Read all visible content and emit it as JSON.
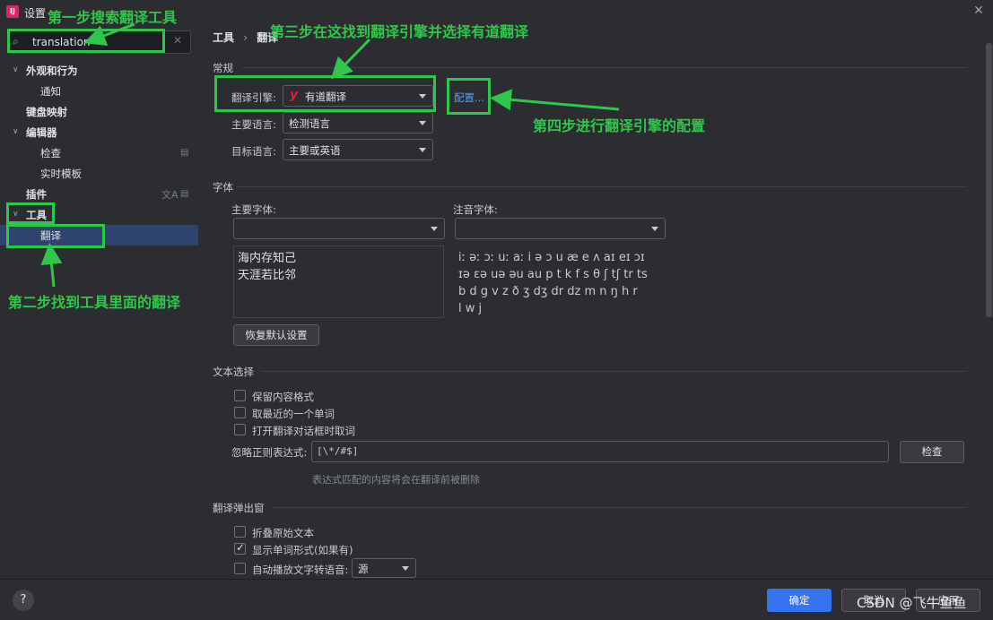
{
  "window": {
    "title": "设置",
    "logo_text": "IJ"
  },
  "search": {
    "value": "translation"
  },
  "sidebar": {
    "items": [
      {
        "label": "外观和行为"
      },
      {
        "label": "通知"
      },
      {
        "label": "键盘映射"
      },
      {
        "label": "编辑器"
      },
      {
        "label": "检查"
      },
      {
        "label": "实时模板"
      },
      {
        "label": "插件"
      },
      {
        "label": "工具"
      },
      {
        "label": "翻译"
      }
    ]
  },
  "breadcrumb": {
    "parent": "工具",
    "sep": "›",
    "current": "翻译"
  },
  "general": {
    "title": "常规",
    "engine_label": "翻译引擎:",
    "engine_value": "有道翻译",
    "engine_logo": "y",
    "configure_link": "配置...",
    "primary_lang_label": "主要语言:",
    "primary_lang_value": "检测语言",
    "target_lang_label": "目标语言:",
    "target_lang_value": "主要或英语"
  },
  "font": {
    "title": "字体",
    "primary_font_label": "主要字体:",
    "phonetic_font_label": "注音字体:",
    "preview_line1": "海内存知己",
    "preview_line2": "天涯若比邻",
    "phonetic_line1": "iː əː ɔː uː aː i ə ɔ u æ e ʌ aɪ eɪ ɔɪ",
    "phonetic_line2": "ɪə ɛə uə əu au p t k f s θ ʃ tʃ tr ts",
    "phonetic_line3": "b d g v z ð ʒ dʒ dr dz m n ŋ h r",
    "phonetic_line4": "l w j",
    "restore_button": "恢复默认设置"
  },
  "text_selection": {
    "title": "文本选择",
    "opt1": "保留内容格式",
    "opt2": "取最近的一个单词",
    "opt3": "打开翻译对话框时取词",
    "regex_label": "忽略正则表达式:",
    "regex_value": "[\\*/#$]",
    "check_button": "检查",
    "hint": "表达式匹配的内容将会在翻译前被删除"
  },
  "popup": {
    "title": "翻译弹出窗",
    "opt1": "折叠原始文本",
    "opt2": "显示单词形式(如果有)",
    "opt3": "自动播放文字转语音:",
    "tts_value": "源"
  },
  "footer": {
    "help": "?",
    "ok": "确定",
    "cancel": "取消",
    "apply": "应用"
  },
  "annotations": {
    "step1": "第一步搜索翻译工具",
    "step2": "第二步找到工具里面的翻译",
    "step3": "第三步在这找到翻译引擎并选择有道翻译",
    "step4": "第四步进行翻译引擎的配置"
  },
  "watermark": "CSDN @飞牛鱼鱼",
  "colors": {
    "accent": "#3574f0",
    "annotation": "#2fc74b",
    "selection": "#2e436e",
    "link": "#589df6"
  }
}
